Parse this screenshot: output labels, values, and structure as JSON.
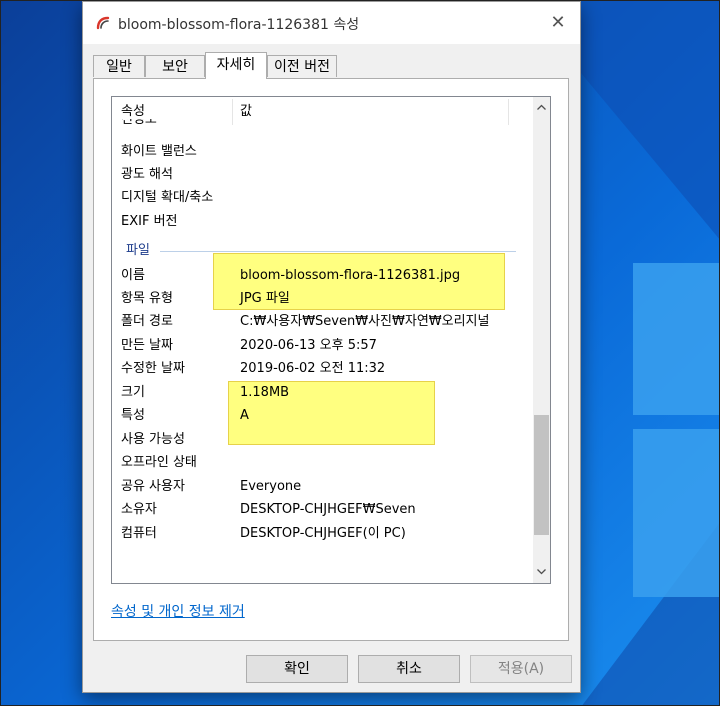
{
  "window": {
    "title": "bloom-blossom-flora-1126381 속성",
    "close_glyph": "✕"
  },
  "tabs": [
    {
      "label": "일반",
      "active": false
    },
    {
      "label": "보안",
      "active": false
    },
    {
      "label": "자세히",
      "active": true
    },
    {
      "label": "이전 버전",
      "active": false
    }
  ],
  "details": {
    "headers": {
      "property": "속성",
      "value": "값"
    },
    "top_rows": [
      {
        "key": "선명도",
        "value": ""
      },
      {
        "key": "화이트 밸런스",
        "value": ""
      },
      {
        "key": "광도 해석",
        "value": ""
      },
      {
        "key": "디지털 확대/축소",
        "value": ""
      },
      {
        "key": "EXIF 버전",
        "value": ""
      }
    ],
    "group_file": "파일",
    "file_rows": [
      {
        "key": "이름",
        "value": "bloom-blossom-flora-1126381.jpg"
      },
      {
        "key": "항목 유형",
        "value": "JPG 파일"
      },
      {
        "key": "폴더 경로",
        "value": "C:₩사용자₩Seven₩사진₩자연₩오리지널"
      },
      {
        "key": "만든 날짜",
        "value": "2020-06-13 오후 5:57"
      },
      {
        "key": "수정한 날짜",
        "value": "2019-06-02 오전 11:32"
      },
      {
        "key": "크기",
        "value": "1.18MB"
      },
      {
        "key": "특성",
        "value": "A"
      },
      {
        "key": "사용 가능성",
        "value": ""
      },
      {
        "key": "오프라인 상태",
        "value": ""
      },
      {
        "key": "공유 사용자",
        "value": "Everyone"
      },
      {
        "key": "소유자",
        "value": "DESKTOP-CHJHGEF₩Seven"
      },
      {
        "key": "컴퓨터",
        "value": "DESKTOP-CHJHGEF(이 PC)"
      }
    ],
    "scroll_position": 0.92
  },
  "remove_link": "속성 및 개인 정보 제거",
  "buttons": {
    "ok": "확인",
    "cancel": "취소",
    "apply": "적용(A)"
  },
  "colors": {
    "desktop": "#0a5cc2",
    "highlight": "#ffff80",
    "link": "#0066cc",
    "group_label": "#1e3d8c",
    "app_icon": "#d9362b"
  }
}
